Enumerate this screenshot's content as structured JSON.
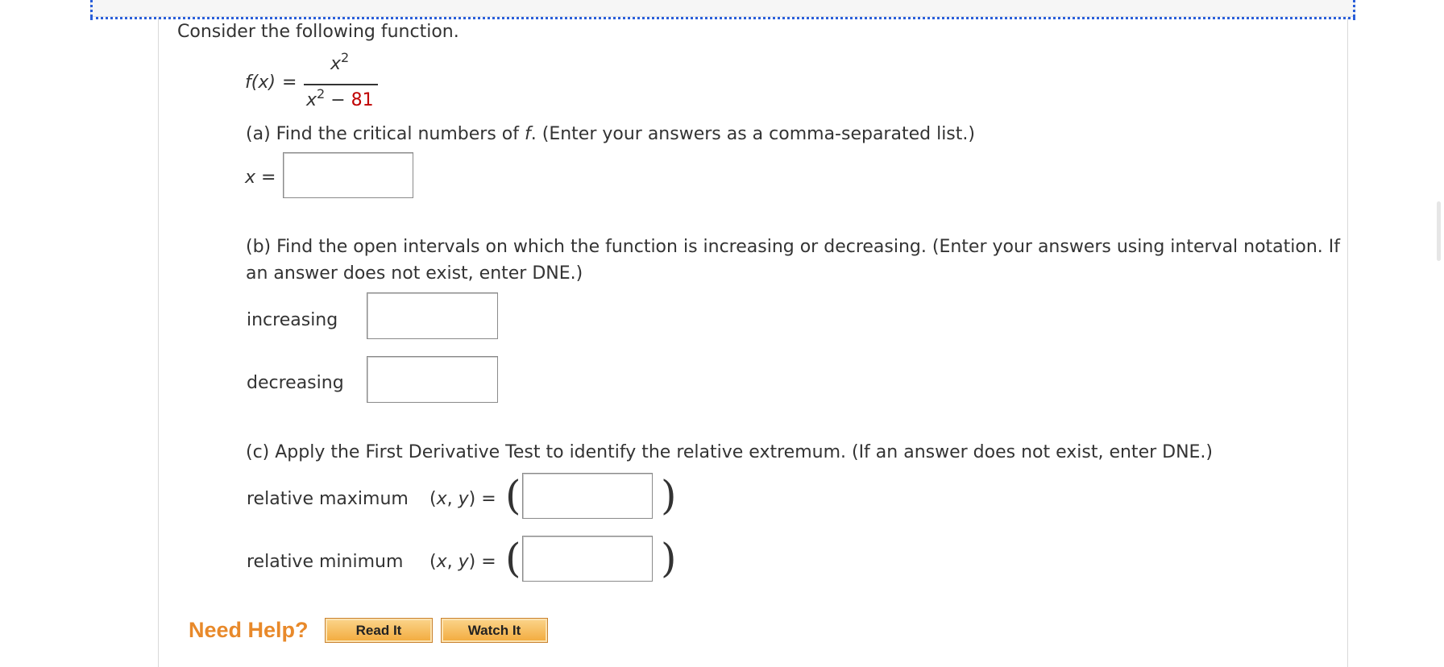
{
  "question": {
    "intro": "Consider the following function.",
    "function": {
      "lhs": "f(x)",
      "equals": "=",
      "numerator_var": "x",
      "numerator_exp": "2",
      "denominator_var": "x",
      "denominator_exp": "2",
      "denominator_op": " − ",
      "denominator_const": "81"
    },
    "part_a": {
      "prefix": "(a) Find the critical numbers of ",
      "fvar": "f",
      "suffix": ". (Enter your answers as a comma-separated list.)",
      "label_var": "x",
      "label_eq": " =",
      "answer_value": ""
    },
    "part_b": {
      "line1": "(b) Find the open intervals on which the function is increasing or decreasing. (Enter your answers using interval notation. If",
      "line2": "an answer does not exist, enter DNE.)",
      "increasing_label": "increasing",
      "decreasing_label": "decreasing",
      "increasing_value": "",
      "decreasing_value": ""
    },
    "part_c": {
      "text": "(c) Apply the First Derivative Test to identify the relative extremum. (If an answer does not exist, enter DNE.)",
      "max_label": "relative maximum",
      "min_label": "relative minimum",
      "xy_open": "(",
      "xy_x": "x",
      "xy_comma": ", ",
      "xy_y": "y",
      "xy_close": ")",
      "xy_eq": "  =",
      "max_value": "",
      "min_value": "",
      "paren_open": "(",
      "paren_close": ")"
    }
  },
  "help": {
    "title": "Need Help?",
    "read_label": "Read It",
    "watch_label": "Watch It"
  },
  "colors": {
    "accent_red": "#c00000",
    "help_orange": "#e8892a",
    "focus_dotted": "#2b5fd9"
  }
}
